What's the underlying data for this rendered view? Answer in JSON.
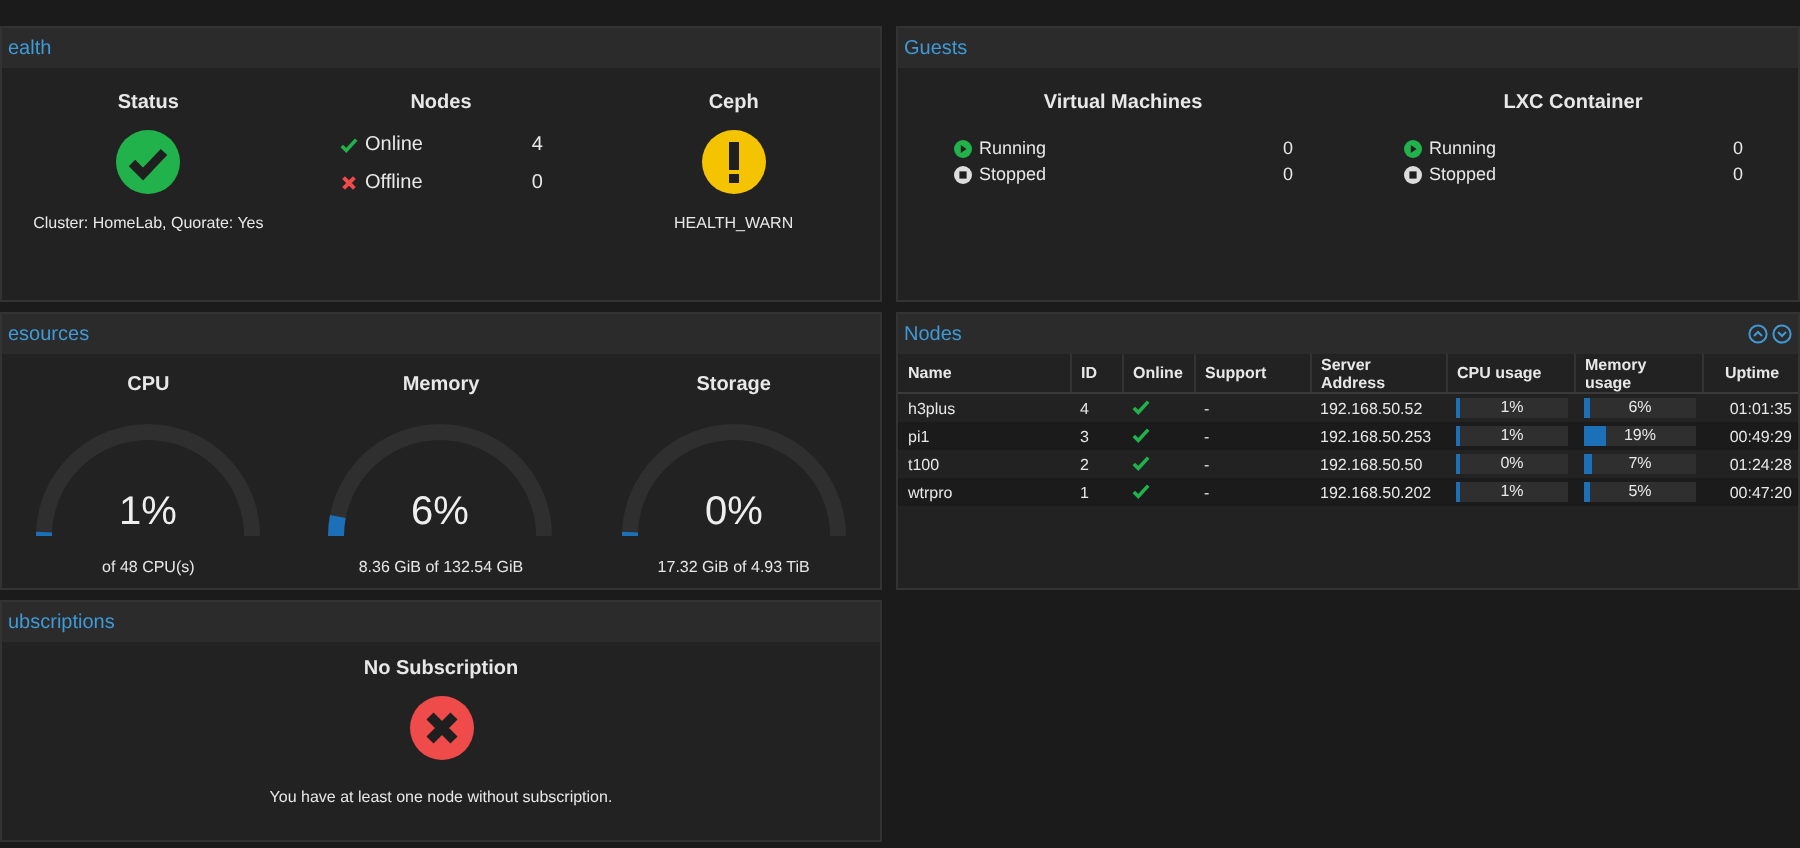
{
  "health": {
    "title": "ealth",
    "status": {
      "heading": "Status",
      "kind": "ok",
      "caption": "Cluster: HomeLab, Quorate: Yes"
    },
    "nodes": {
      "heading": "Nodes",
      "items": [
        {
          "kind": "online",
          "label": "Online",
          "count": "4"
        },
        {
          "kind": "offline",
          "label": "Offline",
          "count": "0"
        }
      ]
    },
    "ceph": {
      "heading": "Ceph",
      "kind": "warn",
      "caption": "HEALTH_WARN"
    }
  },
  "guests": {
    "title": "Guests",
    "groups": [
      {
        "heading": "Virtual Machines",
        "items": [
          {
            "kind": "running",
            "label": "Running",
            "count": "0"
          },
          {
            "kind": "stopped",
            "label": "Stopped",
            "count": "0"
          }
        ]
      },
      {
        "heading": "LXC Container",
        "items": [
          {
            "kind": "running",
            "label": "Running",
            "count": "0"
          },
          {
            "kind": "stopped",
            "label": "Stopped",
            "count": "0"
          }
        ]
      }
    ]
  },
  "resources": {
    "title": "esources",
    "gauges": [
      {
        "label": "CPU",
        "reading": "1%",
        "level": 0.01,
        "caption": "of 48 CPU(s)"
      },
      {
        "label": "Memory",
        "reading": "6%",
        "level": 0.06,
        "caption": "8.36 GiB of 132.54 GiB"
      },
      {
        "label": "Storage",
        "reading": "0%",
        "level": 0.0,
        "caption": "17.32 GiB of 4.93 TiB"
      }
    ]
  },
  "nodes": {
    "title": "Nodes",
    "columns": [
      "Name",
      "ID",
      "Online",
      "Support",
      "Server Address",
      "CPU usage",
      "Memory usage",
      "Uptime"
    ],
    "rows": [
      {
        "name": "h3plus",
        "id": "4",
        "online": true,
        "support": "-",
        "address": "192.168.50.52",
        "cpu": {
          "reading": "1%",
          "level": 0.01
        },
        "memory": {
          "reading": "6%",
          "level": 0.06
        },
        "uptime": "01:01:35"
      },
      {
        "name": "pi1",
        "id": "3",
        "online": true,
        "support": "-",
        "address": "192.168.50.253",
        "cpu": {
          "reading": "1%",
          "level": 0.01
        },
        "memory": {
          "reading": "19%",
          "level": 0.19
        },
        "uptime": "00:49:29"
      },
      {
        "name": "t100",
        "id": "2",
        "online": true,
        "support": "-",
        "address": "192.168.50.50",
        "cpu": {
          "reading": "0%",
          "level": 0.0
        },
        "memory": {
          "reading": "7%",
          "level": 0.07
        },
        "uptime": "01:24:28"
      },
      {
        "name": "wtrpro",
        "id": "1",
        "online": true,
        "support": "-",
        "address": "192.168.50.202",
        "cpu": {
          "reading": "1%",
          "level": 0.01
        },
        "memory": {
          "reading": "5%",
          "level": 0.05
        },
        "uptime": "00:47:20"
      }
    ]
  },
  "subscriptions": {
    "title": "ubscriptions",
    "heading": "No Subscription",
    "kind": "error",
    "message": "You have at least one node without subscription."
  }
}
